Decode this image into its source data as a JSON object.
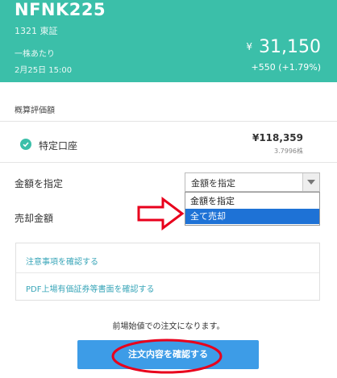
{
  "header": {
    "ticker": "NFNK225",
    "code": "1321 東証",
    "per_share": "一株あたり",
    "datetime": "2月25日 15:00",
    "currency": "¥",
    "price": "31,150",
    "change": "+550 (+1.79%)",
    "bg_color": "#3bbfa9"
  },
  "valuation": {
    "label": "概算評価額",
    "account_name": "特定口座",
    "value": "¥118,359",
    "sub": "3.7996株"
  },
  "amount": {
    "label": "金額を指定",
    "selected": "金額を指定",
    "options": [
      "金額を指定",
      "全て売却"
    ]
  },
  "sell": {
    "label": "売却金額"
  },
  "links": {
    "notes": "注意事項を確認する",
    "pdf": "PDF上場有価証券等書面を確認する"
  },
  "notice": "前場始値での注文になります。",
  "confirm_button": "注文内容を確認する",
  "colors": {
    "accent": "#3bbfa9",
    "button": "#3d9ce7",
    "annotation": "#e8001c",
    "selected_option": "#1e72d6"
  },
  "icons": {
    "check": "check-circle-icon",
    "dropdown": "chevron-down-icon",
    "annotation_arrow": "right-arrow-icon"
  }
}
